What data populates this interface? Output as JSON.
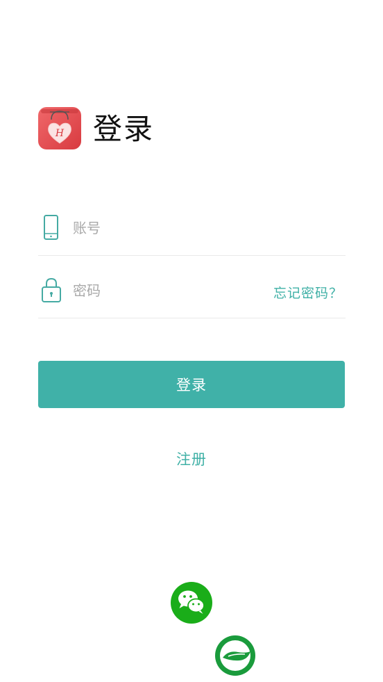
{
  "header": {
    "title": "登录",
    "logo_icon": "heart-shopping-bag-icon",
    "logo_letter": "H"
  },
  "form": {
    "account_placeholder": "账号",
    "account_value": "",
    "account_icon": "phone-icon",
    "password_placeholder": "密码",
    "password_value": "",
    "password_icon": "lock-icon",
    "forgot_label": "忘记密码？"
  },
  "actions": {
    "login_label": "登录",
    "register_label": "注册"
  },
  "social": {
    "wechat_icon": "wechat-icon",
    "other_icon": "leaf-g-icon"
  },
  "colors": {
    "accent": "#40b1a8",
    "logo_red": "#e0484d",
    "wechat_green": "#1aad19"
  }
}
